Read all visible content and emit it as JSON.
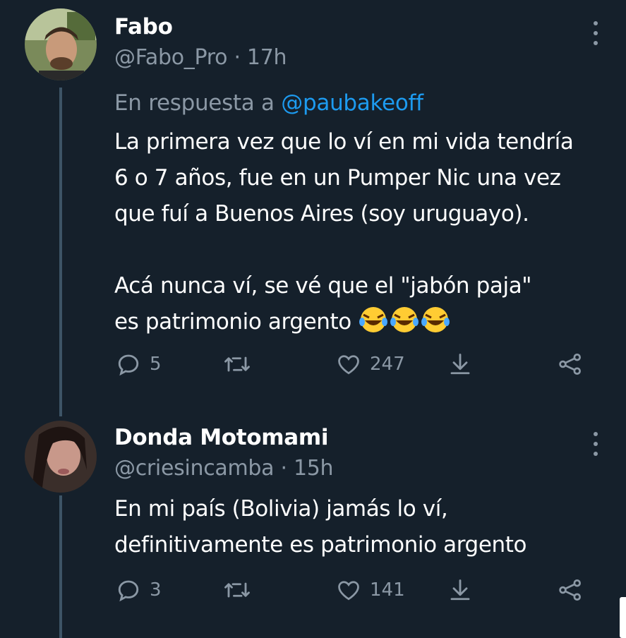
{
  "tweets": [
    {
      "name": "Fabo",
      "handle": "@Fabo_Pro",
      "time": "· 17h",
      "reply_prefix": "En respuesta a",
      "reply_mention": "@paubakeoff",
      "text_part1": "La primera vez que lo ví en mi vida tendría\n6 o 7 años, fue en un Pumper Nic una vez\nque fuí a Buenos Aires (soy uruguayo).\n\nAcá nunca ví, se vé que el \"jabón paja\"\nes patrimonio argento ",
      "emojis": [
        "rolling-on-floor-laughing",
        "rolling-on-floor-laughing",
        "rolling-on-floor-laughing"
      ],
      "replies": "5",
      "retweets": "",
      "likes": "247"
    },
    {
      "name": "Donda Motomami",
      "handle": "@criesincamba",
      "time": "· 15h",
      "text_part1": "En mi país (Bolivia) jamás lo ví,\ndefinitivamente es patrimonio argento",
      "replies": "3",
      "retweets": "",
      "likes": "141"
    }
  ],
  "colors": {
    "background": "#15202b",
    "text": "#ffffff",
    "secondary": "#8b98a5",
    "link": "#1d9bf0",
    "thread": "#3d5466"
  }
}
